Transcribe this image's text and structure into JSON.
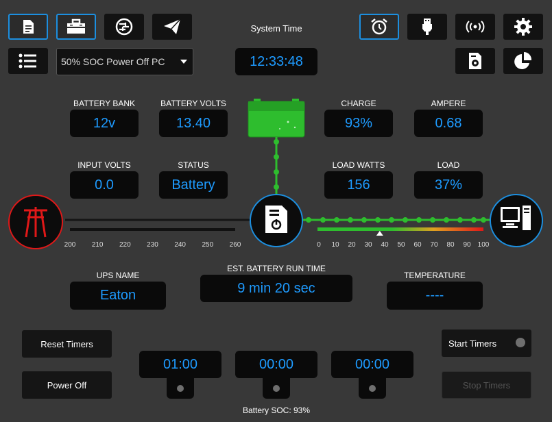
{
  "toolbar": {
    "left_icons": [
      "document-icon",
      "battery-case-icon",
      "network-globe-icon",
      "send-icon"
    ],
    "right_icons": [
      "alarm-clock-icon",
      "usb-plug-icon",
      "broadcast-icon",
      "gear-icon"
    ],
    "row2_icons": [
      "report-gear-icon",
      "pie-chart-icon"
    ]
  },
  "menu_icon": "list-icon",
  "mode_select": {
    "value": "50% SOC Power Off PC"
  },
  "system_time": {
    "label": "System Time",
    "value": "12:33:48"
  },
  "stats": {
    "battery_bank": {
      "label": "BATTERY BANK",
      "value": "12v"
    },
    "battery_volts": {
      "label": "BATTERY VOLTS",
      "value": "13.40"
    },
    "charge": {
      "label": "CHARGE",
      "value": "93%"
    },
    "ampere": {
      "label": "AMPERE",
      "value": "0.68"
    },
    "input_volts": {
      "label": "INPUT VOLTS",
      "value": "0.0"
    },
    "status": {
      "label": "STATUS",
      "value": "Battery"
    },
    "load_watts": {
      "label": "LOAD WATTS",
      "value": "156"
    },
    "load": {
      "label": "LOAD",
      "value": "37%"
    }
  },
  "input_scale": [
    "200",
    "210",
    "220",
    "230",
    "240",
    "250",
    "260"
  ],
  "load_scale": [
    "0",
    "10",
    "20",
    "30",
    "40",
    "50",
    "60",
    "70",
    "80",
    "90",
    "100"
  ],
  "load_marker_percent": 37,
  "ups": {
    "name_label": "UPS NAME",
    "name": "Eaton",
    "runtime_label": "EST. BATTERY RUN TIME",
    "runtime": "9 min 20 sec",
    "temp_label": "TEMPERATURE",
    "temp": "----"
  },
  "buttons": {
    "reset_timers": "Reset Timers",
    "power_off": "Power Off",
    "start_timers": "Start Timers",
    "stop_timers": "Stop Timers"
  },
  "timers": [
    "01:00",
    "00:00",
    "00:00"
  ],
  "battery_soc": "Battery SOC: 93%",
  "colors": {
    "accent": "#1c8fe0",
    "value_text": "#1e9bff",
    "power_ok": "#2ebd2e",
    "grid_alert": "#e01818",
    "background": "#383838"
  }
}
